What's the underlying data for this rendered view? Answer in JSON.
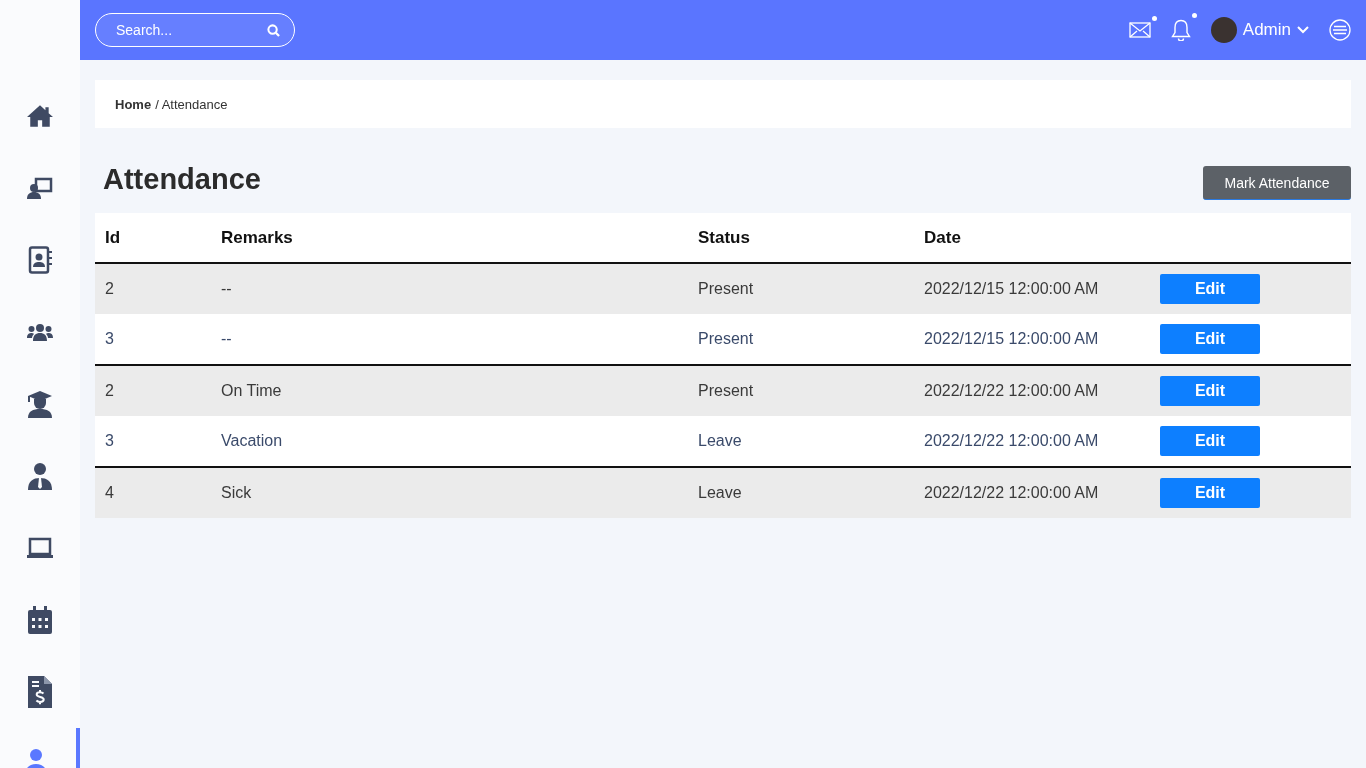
{
  "sidebar": {
    "items": [
      {
        "kind": "home",
        "selected": false
      },
      {
        "kind": "teacher",
        "selected": false
      },
      {
        "kind": "contacts",
        "selected": false
      },
      {
        "kind": "group",
        "selected": false
      },
      {
        "kind": "graduate",
        "selected": false
      },
      {
        "kind": "employee",
        "selected": false
      },
      {
        "kind": "laptop",
        "selected": false
      },
      {
        "kind": "calendar",
        "selected": false
      },
      {
        "kind": "invoice",
        "selected": false
      },
      {
        "kind": "person",
        "selected": true
      }
    ]
  },
  "topbar": {
    "search": {
      "placeholder": "Search..."
    },
    "mail_unread": true,
    "notifications_unread": true,
    "user": "Admin"
  },
  "breadcrumb": {
    "home": "Home",
    "separator": "/",
    "current": "Attendance"
  },
  "page_title": "Attendance",
  "primary_button": "Mark Attendance",
  "table": {
    "columns": [
      "Id",
      "Remarks",
      "Status",
      "Date"
    ],
    "rows": [
      {
        "id": "2",
        "remarks": "--",
        "status": "Present",
        "date": "2022/12/15 12:00:00 AM",
        "action": "Edit",
        "group_start": false
      },
      {
        "id": "3",
        "remarks": "--",
        "status": "Present",
        "date": "2022/12/15 12:00:00 AM",
        "action": "Edit",
        "group_start": false
      },
      {
        "id": "2",
        "remarks": "On Time",
        "status": "Present",
        "date": "2022/12/22 12:00:00 AM",
        "action": "Edit",
        "group_start": true
      },
      {
        "id": "3",
        "remarks": "Vacation",
        "status": "Leave",
        "date": "2022/12/22 12:00:00 AM",
        "action": "Edit",
        "group_start": false
      },
      {
        "id": "4",
        "remarks": "Sick",
        "status": "Leave",
        "date": "2022/12/22 12:00:00 AM",
        "action": "Edit",
        "group_start": true
      }
    ]
  }
}
